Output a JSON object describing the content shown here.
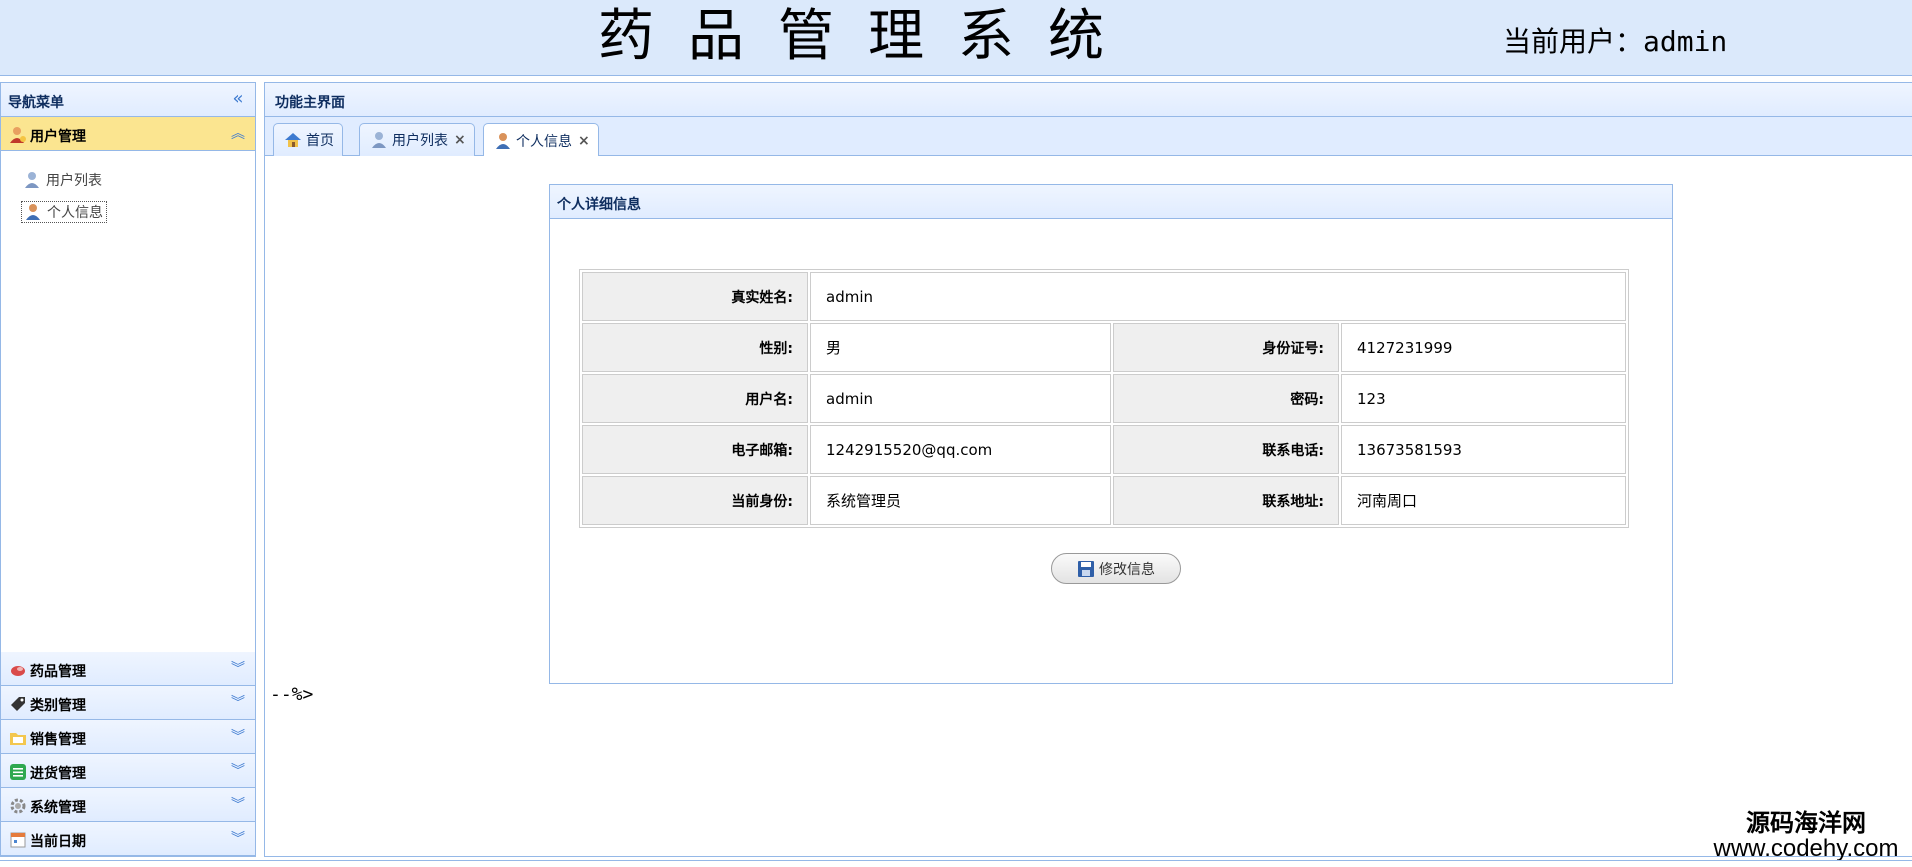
{
  "header": {
    "title": "药品管理系统",
    "user_label": "当前用户：admin"
  },
  "sidebar": {
    "title": "导航菜单",
    "active_panel": {
      "label": "用户管理",
      "items": [
        {
          "label": "用户列表",
          "icon": "user-list-icon"
        },
        {
          "label": "个人信息",
          "icon": "user-icon"
        }
      ]
    },
    "panels": [
      {
        "label": "药品管理",
        "icon": "pill-icon"
      },
      {
        "label": "类别管理",
        "icon": "tag-icon"
      },
      {
        "label": "销售管理",
        "icon": "folder-icon"
      },
      {
        "label": "进货管理",
        "icon": "list-icon"
      },
      {
        "label": "系统管理",
        "icon": "gear-icon"
      },
      {
        "label": "当前日期",
        "icon": "calendar-icon"
      }
    ]
  },
  "main": {
    "title": "功能主界面",
    "tabs": [
      {
        "label": "首页",
        "closable": false
      },
      {
        "label": "用户列表",
        "closable": true
      },
      {
        "label": "个人信息",
        "closable": true,
        "active": true
      }
    ],
    "card": {
      "title": "个人详细信息",
      "rows": {
        "realname": {
          "label": "真实姓名:",
          "value": "admin"
        },
        "gender": {
          "label": "性别:",
          "value": "男"
        },
        "idcard": {
          "label": "身份证号:",
          "value": "4127231999"
        },
        "username": {
          "label": "用户名:",
          "value": "admin"
        },
        "password": {
          "label": "密码:",
          "value": "123"
        },
        "email": {
          "label": "电子邮箱:",
          "value": "1242915520@qq.com"
        },
        "phone": {
          "label": "联系电话:",
          "value": "13673581593"
        },
        "role": {
          "label": "当前身份:",
          "value": "系统管理员"
        },
        "address": {
          "label": "联系地址:",
          "value": "河南周口"
        }
      },
      "edit_button": "修改信息"
    },
    "stray_text": "--%>"
  },
  "watermark": {
    "line1": "源码海洋网",
    "line2": "www.codehy.com"
  },
  "colors": {
    "header_bg": "#dbe9fb",
    "border": "#95b8e7",
    "active_panel": "#fbe590",
    "label_cell": "#efefef"
  }
}
